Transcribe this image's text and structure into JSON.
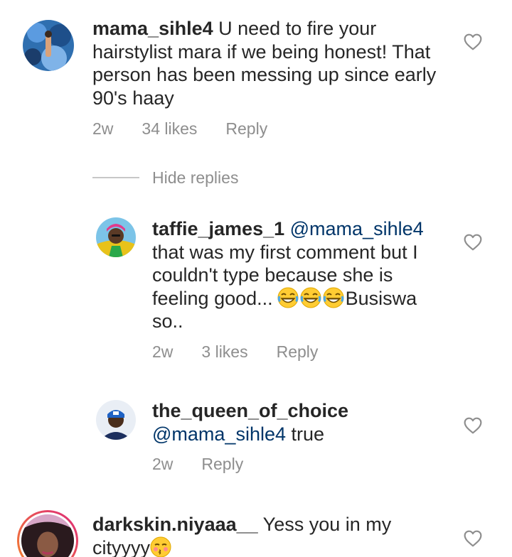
{
  "comments": [
    {
      "username": "mama_sihle4",
      "mention": "",
      "text": "U need to fire your hairstylist mara if we being honest! That person has been messing up since early 90's haay",
      "time": "2w",
      "likes": "34 likes",
      "reply": "Reply"
    },
    {
      "username": "taffie_james_1",
      "mention": "@mama_sihle4",
      "text_before_emoji": "that was my first comment but I couldn't type because she is feeling good...",
      "text_after_emoji": "Busiswa so..",
      "emoji": "tears-of-joy-emoji",
      "time": "2w",
      "likes": "3 likes",
      "reply": "Reply"
    },
    {
      "username": "the_queen_of_choice",
      "mention": "@mama_sihle4",
      "text": "true",
      "time": "2w",
      "reply": "Reply"
    },
    {
      "username": "darkskin.niyaaa__",
      "mention": "",
      "text": "Yess you in my cityyyy",
      "emoji": "kissing-emoji"
    }
  ],
  "hide_replies": "Hide replies",
  "icons": {
    "like": "heart-outline-icon"
  },
  "colors": {
    "text": "#262626",
    "meta": "#8e8e8e",
    "mention": "#003569",
    "story_ring_start": "#f58529",
    "story_ring_end": "#dd2a7b"
  }
}
